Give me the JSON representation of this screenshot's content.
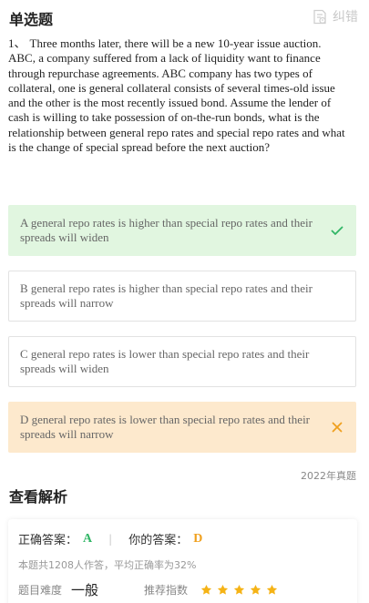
{
  "header": {
    "question_type": "单选题",
    "report_label": "纠错",
    "report_icon": "report-error-icon"
  },
  "question": {
    "number": "1、",
    "text": "Three months later, there will be a new 10-year issue auction. ABC, a company suffered from a lack of liquidity want to finance through repurchase agreements. ABC company has two types of collateral, one is general collateral consists of several times-old issue and the other is the most recently issued bond. Assume the lender of cash is willing to take possession of on-the-run bonds, what is the relationship between general repo rates and special repo rates and what is the change of special spread before the next auction?"
  },
  "options": [
    {
      "text": "A general repo rates is higher than special repo rates and their spreads will widen",
      "state": "correct",
      "icon": "check-icon",
      "color": "#31b666"
    },
    {
      "text": "B general repo rates is higher than special repo rates and their spreads will narrow",
      "state": "none"
    },
    {
      "text": "C general repo rates is lower than special repo rates and their spreads will widen",
      "state": "none"
    },
    {
      "text": "D general repo rates is lower than special repo rates and their spreads will narrow",
      "state": "wrong",
      "icon": "close-icon",
      "color": "#f0a01e"
    }
  ],
  "source": "2022年真题",
  "analysis": {
    "title": "查看解析",
    "correct_label": "正确答案：",
    "correct_value": "A",
    "separator": "|",
    "your_label": "你的答案：",
    "your_value": "D",
    "stats": "本题共1208人作答，平均正确率为32%",
    "difficulty_label": "题目难度",
    "difficulty_value": "一般",
    "recommend_label": "推荐指数",
    "recommend_stars": 5,
    "star_color": "#f5b316"
  }
}
